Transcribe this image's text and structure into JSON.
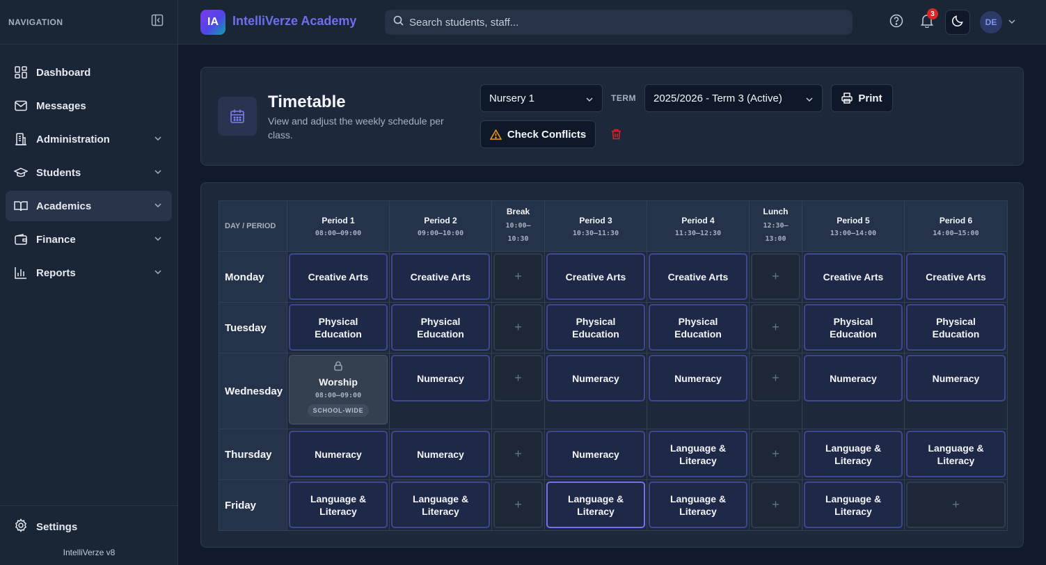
{
  "sidebar": {
    "header_label": "NAVIGATION",
    "items": [
      {
        "label": "Dashboard",
        "icon": "dashboard-icon"
      },
      {
        "label": "Messages",
        "icon": "mail-icon"
      },
      {
        "label": "Administration",
        "icon": "building-icon"
      },
      {
        "label": "Students",
        "icon": "graduation-cap-icon"
      },
      {
        "label": "Academics",
        "icon": "book-open-icon",
        "active": true
      },
      {
        "label": "Finance",
        "icon": "wallet-icon"
      },
      {
        "label": "Reports",
        "icon": "bar-chart-icon"
      }
    ],
    "settings_label": "Settings",
    "version": "IntelliVerze v8"
  },
  "topbar": {
    "logo_initials": "IA",
    "brand": "IntelliVerze Academy",
    "search_placeholder": "Search students, staff...",
    "notification_count": "3",
    "user_initials": "DE"
  },
  "header": {
    "title": "Timetable",
    "subtitle": "View and adjust the weekly schedule per class.",
    "class_select": "Nursery 1",
    "term_label": "TERM",
    "term_select": "2025/2026 - Term 3 (Active)",
    "print_label": "Print",
    "conflicts_label": "Check Conflicts"
  },
  "timetable": {
    "corner_label": "DAY / PERIOD",
    "columns": [
      {
        "name": "Period 1",
        "time": "08:00–09:00"
      },
      {
        "name": "Period 2",
        "time": "09:00–10:00"
      },
      {
        "name": "Break",
        "time1": "10:00–",
        "time2": "10:30"
      },
      {
        "name": "Period 3",
        "time": "10:30–11:30"
      },
      {
        "name": "Period 4",
        "time": "11:30–12:30"
      },
      {
        "name": "Lunch",
        "time1": "12:30–",
        "time2": "13:00"
      },
      {
        "name": "Period 5",
        "time": "13:00–14:00"
      },
      {
        "name": "Period 6",
        "time": "14:00–15:00"
      }
    ],
    "rows": [
      {
        "day": "Monday",
        "cells": [
          "Creative Arts",
          "Creative Arts",
          "",
          "Creative Arts",
          "Creative Arts",
          "",
          "Creative Arts",
          "Creative Arts"
        ]
      },
      {
        "day": "Tuesday",
        "cells": [
          "Physical Education",
          "Physical Education",
          "",
          "Physical Education",
          "Physical Education",
          "",
          "Physical Education",
          "Physical Education"
        ]
      },
      {
        "day": "Wednesday",
        "cells": [
          "Worship",
          "Numeracy",
          "",
          "Numeracy",
          "Numeracy",
          "",
          "Numeracy",
          "Numeracy"
        ]
      },
      {
        "day": "Thursday",
        "cells": [
          "Numeracy",
          "Numeracy",
          "",
          "Numeracy",
          "Language & Literacy",
          "",
          "Language & Literacy",
          "Language & Literacy"
        ]
      },
      {
        "day": "Friday",
        "cells": [
          "Language & Literacy",
          "Language & Literacy",
          "",
          "Language & Literacy",
          "Language & Literacy",
          "",
          "Language & Literacy",
          ""
        ]
      }
    ],
    "worship": {
      "title": "Worship",
      "time": "08:00–09:00",
      "tag": "SCHOOL-WIDE"
    },
    "add_symbol": "+"
  },
  "colors": {
    "accent": "#6366f1",
    "slot_border": "#3c4890",
    "danger": "#dc2626",
    "warning": "#f59e0b"
  }
}
